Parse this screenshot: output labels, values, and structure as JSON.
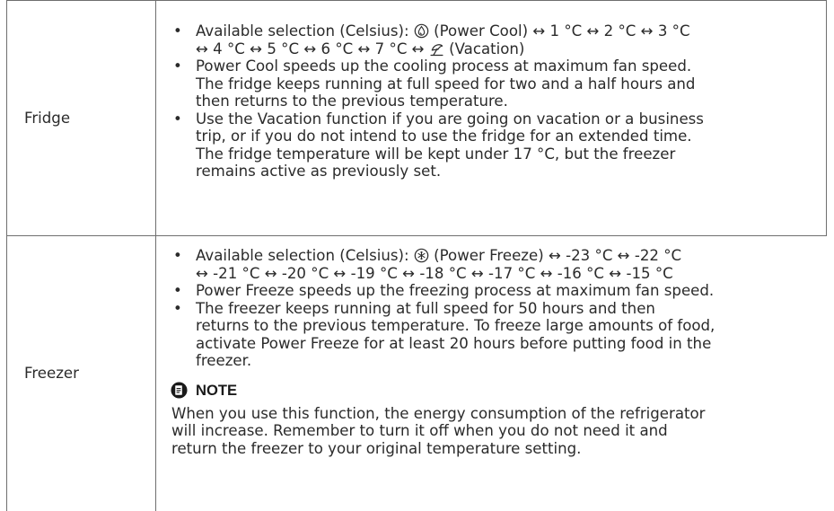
{
  "fridge": {
    "label": "Fridge",
    "items": [
      {
        "lines": [
          [
            "Available selection (Celsius): ",
            {
              "icon": "power-cool-icon"
            },
            " (Power Cool) ↔ 1 °C ↔ 2 °C ↔ 3 °C"
          ],
          [
            "↔ 4 °C ↔ 5 °C ↔ 6 °C ↔ 7 °C ↔ ",
            {
              "icon": "vacation-icon"
            },
            " (Vacation)"
          ]
        ]
      },
      {
        "lines": [
          [
            "Power Cool speeds up the cooling process at maximum fan speed."
          ],
          [
            "The fridge keeps running at full speed for two and a half hours and"
          ],
          [
            "then returns to the previous temperature."
          ]
        ]
      },
      {
        "lines": [
          [
            "Use the Vacation function if you are going on vacation or a business"
          ],
          [
            "trip, or if you do not intend to use the fridge for an extended time."
          ],
          [
            "The fridge temperature will be kept under 17 °C, but the freezer"
          ],
          [
            "remains active as previously set."
          ]
        ]
      }
    ]
  },
  "freezer": {
    "label": "Freezer",
    "items": [
      {
        "lines": [
          [
            "Available selection (Celsius): ",
            {
              "icon": "power-freeze-icon"
            },
            " (Power Freeze) ↔ -23 °C ↔ -22 °C"
          ],
          [
            "↔ -21 °C ↔ -20 °C ↔ -19 °C ↔ -18 °C ↔ -17 °C ↔ -16 °C ↔ -15 °C"
          ]
        ]
      },
      {
        "lines": [
          [
            "Power Freeze speeds up the freezing process at maximum fan speed."
          ]
        ]
      },
      {
        "lines": [
          [
            "The freezer keeps running at full speed for 50 hours and then"
          ],
          [
            "returns to the previous temperature. To freeze large amounts of food,"
          ],
          [
            "activate Power Freeze for at least 20 hours before putting food in the"
          ],
          [
            "freezer."
          ]
        ]
      }
    ],
    "note": {
      "icon": "note-icon",
      "heading": "NOTE",
      "lines": [
        "When you use this function, the energy consumption of the refrigerator",
        "will increase. Remember to turn it off when you do not need it and",
        "return the freezer to your original temperature setting."
      ]
    }
  }
}
